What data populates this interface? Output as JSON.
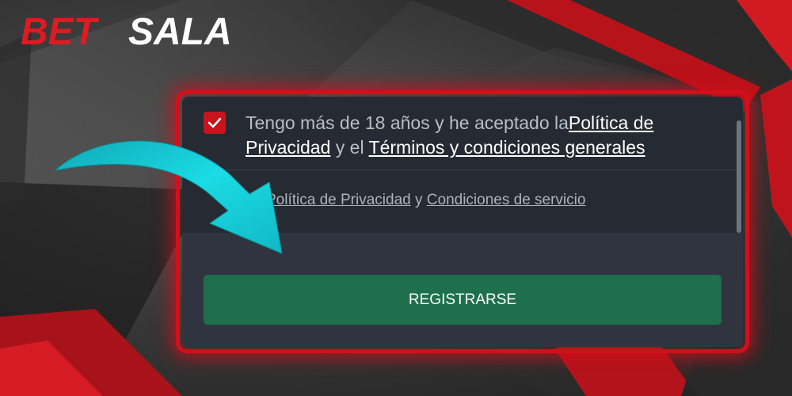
{
  "brand": {
    "logo_part1": "BET",
    "logo_part2": "SALA",
    "accent_color": "#d3101a",
    "panel_color": "#30343f",
    "button_color": "#1e6f4b",
    "arrow_color": "#19d4dc"
  },
  "consent": {
    "checked": true,
    "text_before": "Tengo más de 18 años y he aceptado la",
    "privacy_link": "Política de Privacidad",
    "text_middle": " y el ",
    "terms_link": "Términos y condiciones generales"
  },
  "links": {
    "privacy": "Política de Privacidad",
    "separator": " y ",
    "service": "Condiciones de servicio"
  },
  "register_button": {
    "label": "REGISTRARSE"
  },
  "icons": [
    "checkmark-icon",
    "arrow-pointer"
  ]
}
